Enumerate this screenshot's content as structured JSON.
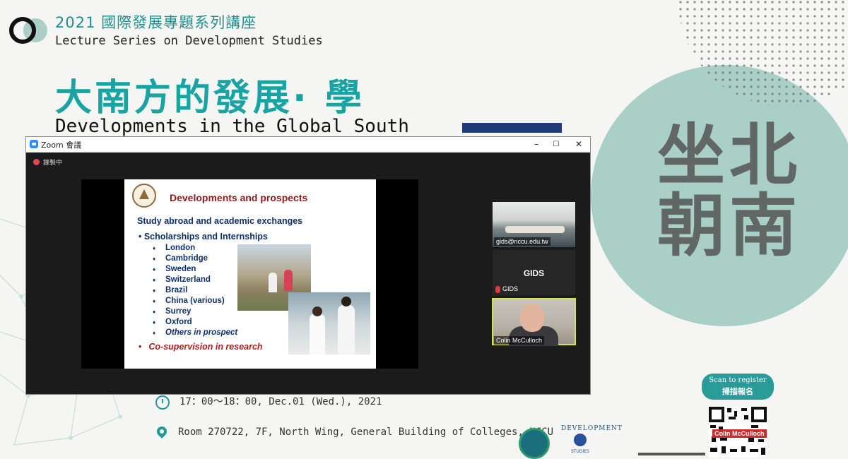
{
  "poster": {
    "series_year_title": "2021 國際發展專題系列講座",
    "series_en": "Lecture Series on Development Studies",
    "main_title_zh": "大南方的發展· 學",
    "main_title_en": "Developments in the Global South",
    "calligraphy": [
      "坐北",
      "朝南"
    ],
    "time": "17：00～18：00, Dec.01 (Wed.), 2021",
    "room": "Room 270722, 7F, North Wing, General Building of Colleges, NCCU",
    "dev_seal_text": "DEVELOPMENT",
    "dev_seal_sub": "STUDIES",
    "scan_line1": "Scan to register",
    "scan_line2": "掃描報名",
    "colors": {
      "teal": "#1aa3a3",
      "navy": "#1e3a78",
      "circle": "#a9cfc6"
    }
  },
  "zoom": {
    "window_title": "Zoom 會議",
    "minimize": "–",
    "maximize": "☐",
    "close": "✕",
    "recording_label": "錄製中",
    "slide": {
      "title": "Developments and prospects",
      "heading": "Study abroad and academic exchanges",
      "subheading": "•   Scholarships and Internships",
      "bullet": "♦",
      "items": [
        "London",
        "Cambridge",
        "Sweden",
        "Switzerland",
        "Brazil",
        "China (various)",
        "Surrey",
        "Oxford"
      ],
      "item_prospect": "Others in prospect",
      "co_bullet": "•",
      "co_supervision": "Co-supervision in research"
    },
    "participants": {
      "room_label": "gids@nccu.edu.tw",
      "gids_name_big": "GIDS",
      "gids_name_small": "GIDS",
      "speaker_label": "Colin McCulloch"
    }
  },
  "overlay": {
    "qr_name_label": "Colin McCulloch"
  }
}
